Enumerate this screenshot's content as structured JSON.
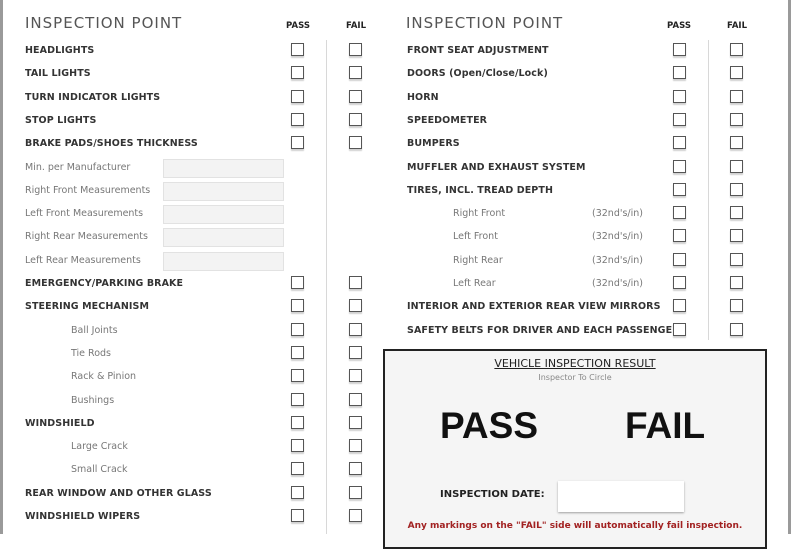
{
  "left_column": {
    "header": "INSPECTION POINT",
    "pass_label": "PASS",
    "fail_label": "FAIL",
    "items": [
      {
        "label": "HEADLIGHTS",
        "type": "main",
        "checkbox": true
      },
      {
        "label": "TAIL LIGHTS",
        "type": "main",
        "checkbox": true
      },
      {
        "label": "TURN INDICATOR LIGHTS",
        "type": "main",
        "checkbox": true
      },
      {
        "label": "STOP LIGHTS",
        "type": "main",
        "checkbox": true
      },
      {
        "label": "BRAKE PADS/SHOES THICKNESS",
        "type": "main",
        "checkbox": true
      },
      {
        "label": "Min. per Manufacturer",
        "type": "measure",
        "value": ""
      },
      {
        "label": "Right Front Measurements",
        "type": "measure",
        "value": ""
      },
      {
        "label": "Left Front Measurements",
        "type": "measure",
        "value": ""
      },
      {
        "label": "Right Rear Measurements",
        "type": "measure",
        "value": ""
      },
      {
        "label": "Left Rear Measurements",
        "type": "measure",
        "value": ""
      },
      {
        "label": "EMERGENCY/PARKING BRAKE",
        "type": "main",
        "checkbox": true
      },
      {
        "label": "STEERING MECHANISM",
        "type": "main",
        "checkbox": true
      },
      {
        "label": "Ball Joints",
        "type": "sub",
        "checkbox": true
      },
      {
        "label": "Tie Rods",
        "type": "sub",
        "checkbox": true
      },
      {
        "label": "Rack & Pinion",
        "type": "sub",
        "checkbox": true
      },
      {
        "label": "Bushings",
        "type": "sub",
        "checkbox": true
      },
      {
        "label": "WINDSHIELD",
        "type": "main",
        "checkbox": true
      },
      {
        "label": "Large Crack",
        "type": "sub",
        "checkbox": true
      },
      {
        "label": "Small Crack",
        "type": "sub",
        "checkbox": true
      },
      {
        "label": "REAR WINDOW AND OTHER GLASS",
        "type": "main",
        "checkbox": true
      },
      {
        "label": "WINDSHIELD WIPERS",
        "type": "main",
        "checkbox": true
      }
    ]
  },
  "right_column": {
    "header": "INSPECTION POINT",
    "pass_label": "PASS",
    "fail_label": "FAIL",
    "items": [
      {
        "label": "FRONT SEAT ADJUSTMENT",
        "type": "main"
      },
      {
        "label": "DOORS (Open/Close/Lock)",
        "type": "main"
      },
      {
        "label": "HORN",
        "type": "main"
      },
      {
        "label": "SPEEDOMETER",
        "type": "main"
      },
      {
        "label": "BUMPERS",
        "type": "main"
      },
      {
        "label": "MUFFLER AND EXHAUST SYSTEM",
        "type": "main"
      },
      {
        "label": "TIRES, INCL. TREAD DEPTH",
        "type": "main"
      },
      {
        "label": "Right Front",
        "type": "sub",
        "unit": "(32nd's/in)"
      },
      {
        "label": "Left Front",
        "type": "sub",
        "unit": "(32nd's/in)"
      },
      {
        "label": "Right Rear",
        "type": "sub",
        "unit": "(32nd's/in)"
      },
      {
        "label": "Left Rear",
        "type": "sub",
        "unit": "(32nd's/in)"
      },
      {
        "label": "INTERIOR AND EXTERIOR REAR VIEW MIRRORS",
        "type": "main"
      },
      {
        "label": "SAFETY BELTS FOR DRIVER AND EACH PASSENGER",
        "type": "main"
      }
    ]
  },
  "result": {
    "title": "VEHICLE INSPECTION RESULT",
    "subtitle": "Inspector To Circle",
    "pass": "PASS",
    "fail": "FAIL",
    "date_label": "INSPECTION DATE:",
    "date_value": "",
    "warning": "Any markings on the \"FAIL\" side will automatically fail inspection.",
    "warning_color": "#a22222"
  }
}
